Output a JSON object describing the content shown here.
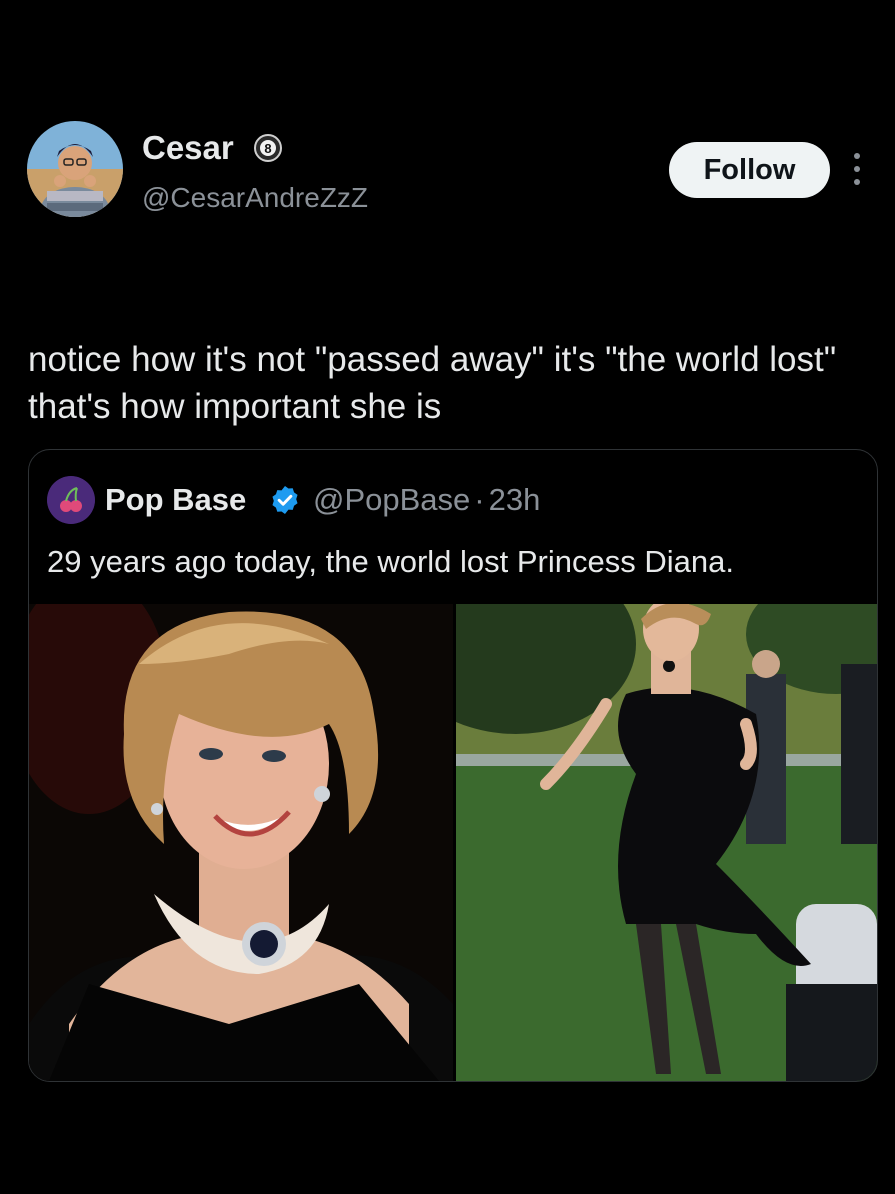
{
  "author": {
    "display_name": "Cesar",
    "handle": "@CesarAndreZzZ",
    "badge_number": "8",
    "follow_label": "Follow"
  },
  "tweet": {
    "text": "notice how it's not \"passed away\" it's \"the world lost\" that's how important she is"
  },
  "quoted": {
    "display_name": "Pop Base",
    "handle": "@PopBase",
    "separator": "·",
    "time": "23h",
    "text": "29 years ago today, the world lost Princess Diana.",
    "verified_color": "#1d9bf0"
  },
  "icons": {
    "more": "more-vertical-icon",
    "verified": "verified-badge-icon",
    "level": "level-badge-icon"
  },
  "colors": {
    "background": "#000000",
    "text_primary": "#e7e9ea",
    "text_secondary": "#8b9198",
    "follow_bg": "#eff3f4",
    "border": "#2f3336"
  }
}
